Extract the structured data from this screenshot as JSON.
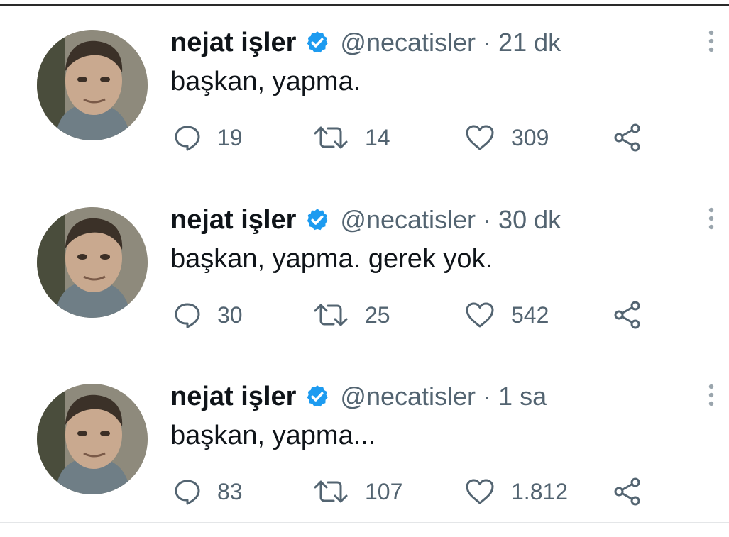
{
  "colors": {
    "name": "#0f1419",
    "secondary": "#536471",
    "verified": "#1d9bf0",
    "divider": "#e4e6e8"
  },
  "icons": {
    "reply": "speech-bubble-icon",
    "retweet": "retweet-arrows-icon",
    "like": "heart-icon",
    "share": "share-nodes-icon",
    "more": "vertical-dots-icon",
    "verified": "verified-badge-icon"
  },
  "tweets": [
    {
      "name": "nejat işler",
      "handle": "@necatisler",
      "separator": "·",
      "time": "21 dk",
      "text": "başkan, yapma.",
      "replies": "19",
      "retweets": "14",
      "likes": "309"
    },
    {
      "name": "nejat işler",
      "handle": "@necatisler",
      "separator": "·",
      "time": "30 dk",
      "text": "başkan, yapma. gerek yok.",
      "replies": "30",
      "retweets": "25",
      "likes": "542"
    },
    {
      "name": "nejat işler",
      "handle": "@necatisler",
      "separator": "·",
      "time": "1 sa",
      "text": "başkan, yapma...",
      "replies": "83",
      "retweets": "107",
      "likes": "1.812"
    }
  ]
}
